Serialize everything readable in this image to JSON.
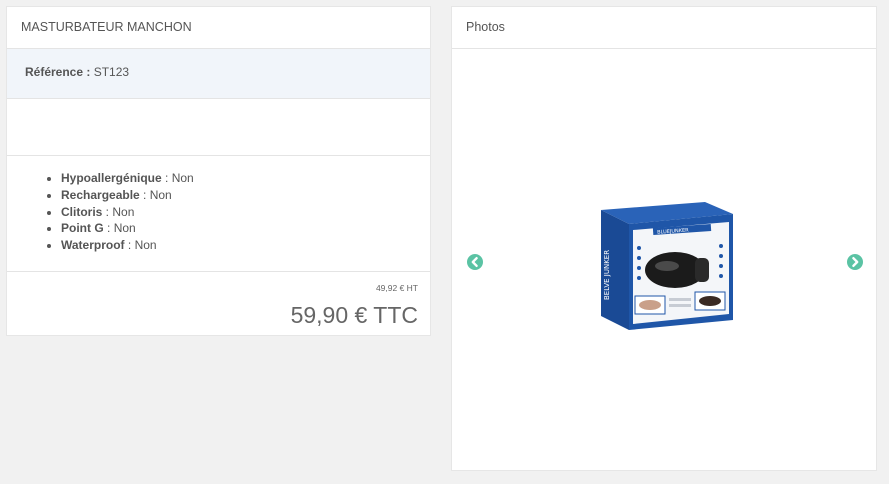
{
  "product": {
    "title": "MASTURBATEUR MANCHON",
    "reference_label": "Référence :",
    "reference_value": "ST123",
    "features": [
      {
        "name": "Hypoallergénique",
        "sep": " : ",
        "value": "Non"
      },
      {
        "name": "Rechargeable",
        "sep": " : ",
        "value": "Non"
      },
      {
        "name": "Clitoris",
        "sep": " : ",
        "value": "Non"
      },
      {
        "name": "Point G",
        "sep": " : ",
        "value": "Non"
      },
      {
        "name": "Waterproof",
        "sep": " : ",
        "value": "Non"
      }
    ],
    "price_ht": "49,92 € HT",
    "price_ttc": "59,90 € TTC"
  },
  "photos": {
    "title": "Photos",
    "prev_icon": "chevron-left-icon",
    "next_icon": "chevron-right-icon",
    "image_brand_text": "BLUEJUNKER",
    "image_side_text": "BELVE JUNKER"
  },
  "colors": {
    "background": "#f1f1f1",
    "panel": "#ffffff",
    "reference_row": "#f1f5fa",
    "arrow": "#5bc3a4",
    "box_blue": "#1f56a8"
  }
}
